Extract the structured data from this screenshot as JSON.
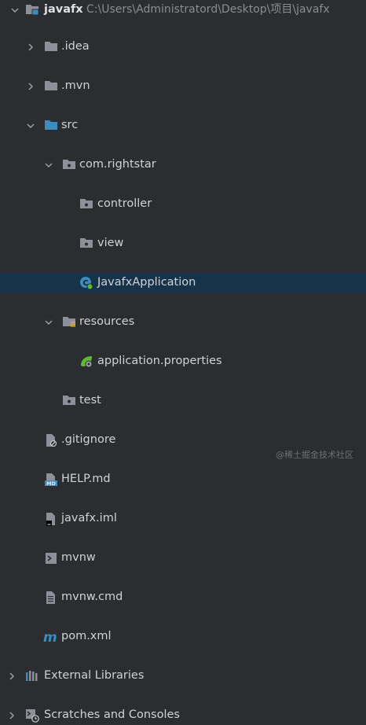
{
  "tree": {
    "root": {
      "label": "javafx",
      "path": "C:\\Users\\Administratord\\Desktop\\项目\\javafx"
    },
    "items": [
      {
        "label": ".idea"
      },
      {
        "label": ".mvn"
      },
      {
        "label": "src"
      },
      {
        "label": "com.rightstar"
      },
      {
        "label": "controller"
      },
      {
        "label": "view"
      },
      {
        "label": "JavafxApplication"
      },
      {
        "label": "resources"
      },
      {
        "label": "application.properties"
      },
      {
        "label": "test"
      },
      {
        "label": ".gitignore"
      },
      {
        "label": "HELP.md"
      },
      {
        "label": "javafx.iml"
      },
      {
        "label": "mvnw"
      },
      {
        "label": "mvnw.cmd"
      },
      {
        "label": "pom.xml"
      },
      {
        "label": "External Libraries"
      },
      {
        "label": "Scratches and Consoles"
      }
    ],
    "selected_item": "JavafxApplication"
  },
  "watermark": "@稀土掘金技术社区",
  "colors": {
    "background": "#2b2d30",
    "selection": "#163349",
    "folder": "#8c9099",
    "source_folder": "#3c8dbe",
    "spring_green": "#5fb832"
  },
  "icons": {
    "root": "module-folder-icon",
    ".idea": "folder-icon",
    ".mvn": "folder-icon",
    "src": "source-folder-icon",
    "com.rightstar": "package-icon",
    "controller": "package-icon",
    "view": "package-icon",
    "JavafxApplication": "spring-boot-class-icon",
    "resources": "resources-folder-icon",
    "application.properties": "spring-properties-icon",
    "test": "package-icon",
    ".gitignore": "gitignore-file-icon",
    "HELP.md": "markdown-file-icon",
    "javafx.iml": "iml-file-icon",
    "mvnw": "shell-script-icon",
    "mvnw.cmd": "text-file-icon",
    "pom.xml": "maven-icon",
    "External Libraries": "libraries-icon",
    "Scratches and Consoles": "scratches-icon"
  }
}
